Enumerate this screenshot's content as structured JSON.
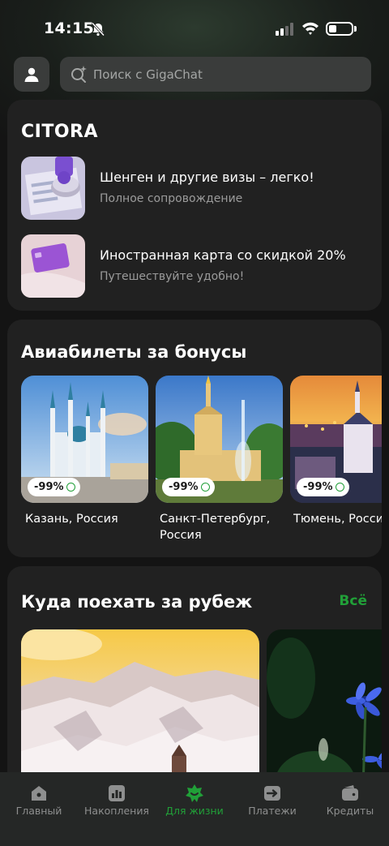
{
  "status_bar": {
    "time": "14:15"
  },
  "header": {
    "search_placeholder": "Поиск с GigaChat",
    "profile_icon": "user-icon",
    "search_icon": "gigachat-search-icon"
  },
  "citora": {
    "title": "CITORA",
    "items": [
      {
        "title": "Шенген и другие визы – легко!",
        "subtitle": "Полное сопровождение"
      },
      {
        "title": "Иностранная карта со скидкой 20%",
        "subtitle": "Путешествуйте удобно!"
      }
    ]
  },
  "flights": {
    "title": "Авиабилеты за бонусы",
    "cities": [
      {
        "name": "Казань, Россия",
        "badge": "-99%"
      },
      {
        "name": "Санкт-Петербург, Россия",
        "badge": "-99%"
      },
      {
        "name": "Тюмень, Россия",
        "badge": "-99%"
      }
    ]
  },
  "abroad": {
    "title": "Куда поехать за рубеж",
    "all_link": "Всё"
  },
  "bottom_nav": {
    "items": [
      {
        "label": "Главный",
        "icon": "home-icon"
      },
      {
        "label": "Накопления",
        "icon": "chart-icon"
      },
      {
        "label": "Для жизни",
        "icon": "star-icon"
      },
      {
        "label": "Платежи",
        "icon": "transfer-icon"
      },
      {
        "label": "Кредиты",
        "icon": "wallet-icon"
      }
    ],
    "active": "Для жизни"
  },
  "colors": {
    "accent": "#21a038",
    "background": "#141414",
    "card": "#212121"
  }
}
